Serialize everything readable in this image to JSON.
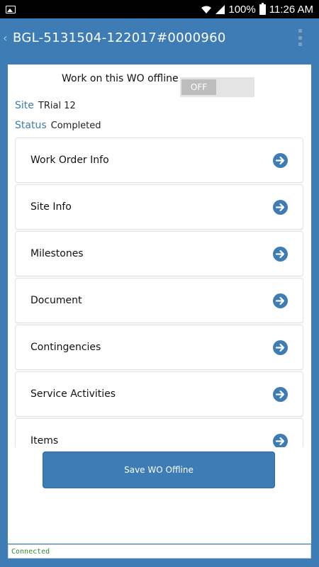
{
  "status_bar": {
    "battery": "100%",
    "time": "11:26 AM"
  },
  "app_bar": {
    "title": "BGL-5131504-122017#0000960"
  },
  "offline": {
    "label": "Work on this WO offline",
    "toggle_state": "OFF"
  },
  "site": {
    "key": "Site",
    "value": "TRial 12"
  },
  "status": {
    "key": "Status",
    "value": "Completed"
  },
  "menu": [
    {
      "label": "Work Order Info"
    },
    {
      "label": "Site Info"
    },
    {
      "label": "Milestones"
    },
    {
      "label": "Document"
    },
    {
      "label": "Contingencies"
    },
    {
      "label": "Service Activities"
    },
    {
      "label": "Items"
    }
  ],
  "save_button": {
    "label": "Save WO Offline"
  },
  "connection": {
    "text": "Connected"
  },
  "colors": {
    "primary": "#3d7cb4",
    "connected": "#2e8b2e"
  }
}
